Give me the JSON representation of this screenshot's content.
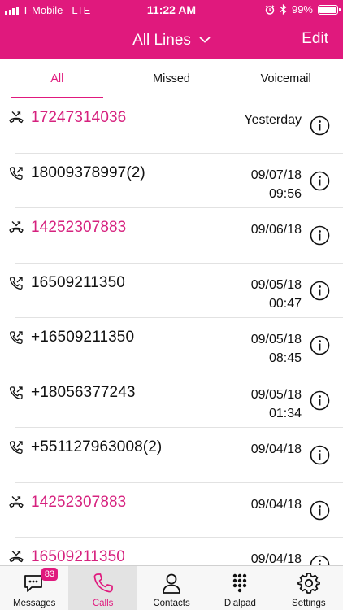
{
  "status_bar": {
    "carrier": "T-Mobile",
    "network": "LTE",
    "time": "11:22 AM",
    "battery": "99%",
    "battery_level": 0.99,
    "icons": [
      "signal-bars",
      "alarm-clock",
      "bluetooth",
      "battery"
    ]
  },
  "header": {
    "title": "All Lines",
    "edit_label": "Edit"
  },
  "tabs": [
    {
      "label": "All",
      "active": true
    },
    {
      "label": "Missed",
      "active": false
    },
    {
      "label": "Voicemail",
      "active": false
    }
  ],
  "calls": [
    {
      "number": "17247314036",
      "date": "Yesterday",
      "time": "",
      "type": "missed"
    },
    {
      "number": "18009378997(2)",
      "date": "09/07/18",
      "time": "09:56",
      "type": "outgoing"
    },
    {
      "number": "14252307883",
      "date": "09/06/18",
      "time": "",
      "type": "missed"
    },
    {
      "number": "16509211350",
      "date": "09/05/18",
      "time": "00:47",
      "type": "outgoing"
    },
    {
      "number": "+16509211350",
      "date": "09/05/18",
      "time": "08:45",
      "type": "outgoing"
    },
    {
      "number": "+18056377243",
      "date": "09/05/18",
      "time": "01:34",
      "type": "outgoing"
    },
    {
      "number": "+551127963008(2)",
      "date": "09/04/18",
      "time": "",
      "type": "outgoing"
    },
    {
      "number": "14252307883",
      "date": "09/04/18",
      "time": "",
      "type": "missed"
    },
    {
      "number": "16509211350",
      "date": "09/04/18",
      "time": "",
      "type": "missed"
    }
  ],
  "tab_bar": {
    "messages_label": "Messages",
    "messages_badge": "83",
    "calls_label": "Calls",
    "contacts_label": "Contacts",
    "dialpad_label": "Dialpad",
    "settings_label": "Settings"
  },
  "colors": {
    "accent": "#e0197d",
    "missed": "#d6217e",
    "text": "#111111"
  }
}
